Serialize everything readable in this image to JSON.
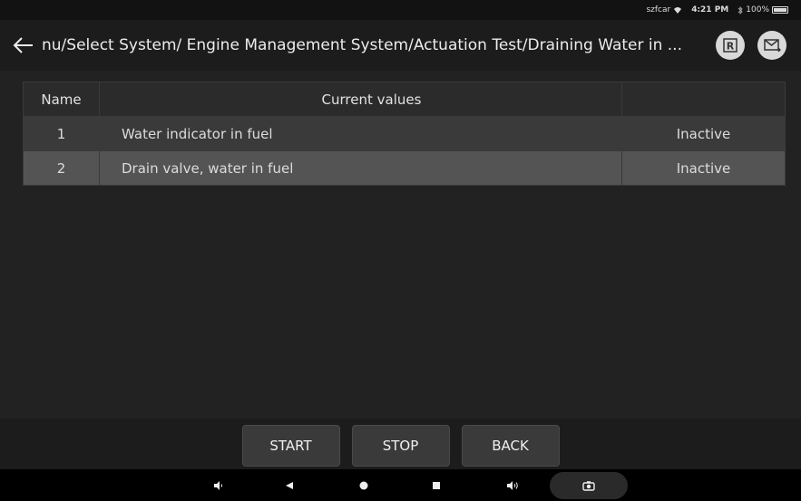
{
  "status_bar": {
    "carrier": "szfcar",
    "time": "4:21 PM",
    "battery": "100%"
  },
  "header": {
    "title": "nu/Select System/ Engine Management System/Actuation Test/Draining Water in ...",
    "icons": [
      "back-arrow-icon",
      "report-icon",
      "mail-icon"
    ],
    "report_letter": "R"
  },
  "table": {
    "columns": [
      "Name",
      "Current values",
      ""
    ],
    "rows": [
      {
        "name": "1",
        "value": "Water indicator in fuel",
        "status": "Inactive"
      },
      {
        "name": "2",
        "value": "Drain valve, water in fuel",
        "status": "Inactive"
      }
    ]
  },
  "buttons": {
    "start": "START",
    "stop": "STOP",
    "back": "BACK"
  },
  "nav": [
    "volume-down-icon",
    "back-triangle-icon",
    "home-circle-icon",
    "recents-square-icon",
    "volume-up-icon",
    "camera-icon"
  ],
  "colors": {
    "background": "#1f1f1f",
    "row_selected": "#545454",
    "row": "#3a3a3a"
  }
}
